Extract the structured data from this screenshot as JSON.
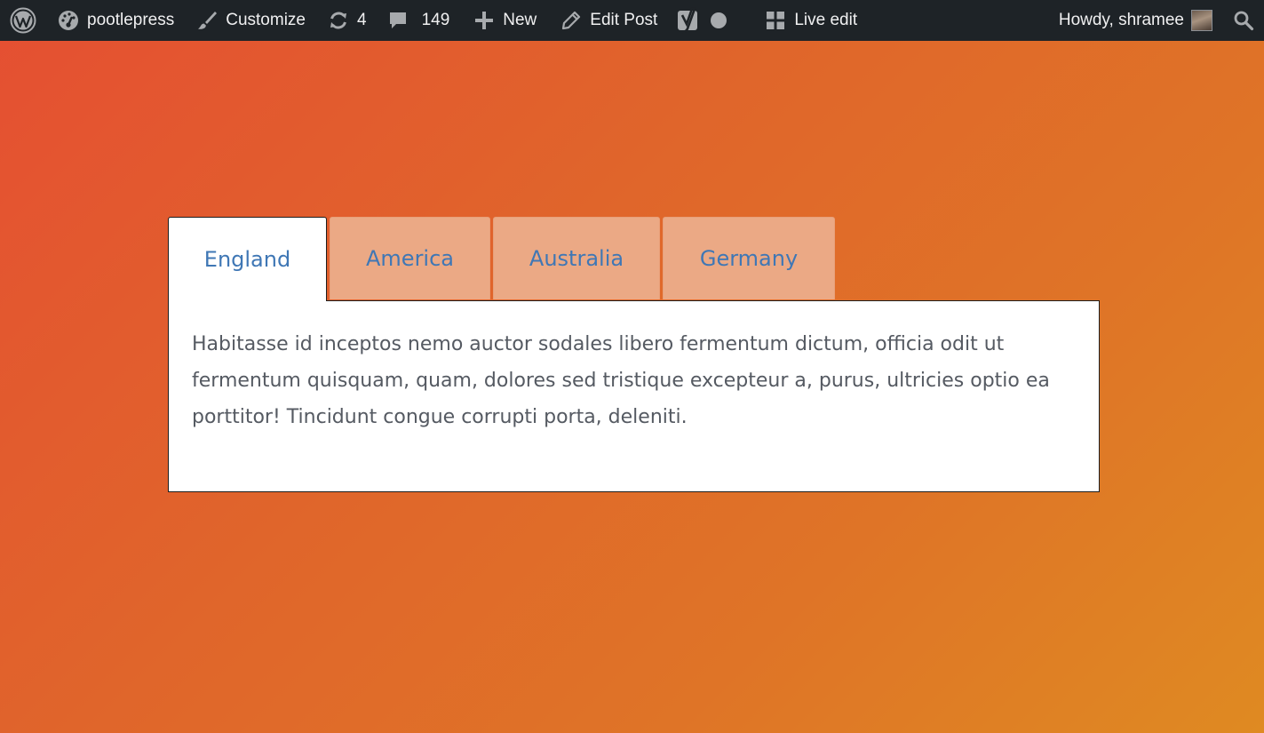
{
  "admin_bar": {
    "site_name": "pootlepress",
    "customize": "Customize",
    "updates_count": "4",
    "comments_count": "149",
    "new_label": "New",
    "edit_post": "Edit Post",
    "live_edit": "Live edit",
    "howdy": "Howdy, shramee",
    "icons": {
      "wordpress": "wordpress-logo-icon",
      "dashboard": "dashboard-gauge-icon",
      "customize": "paintbrush-icon",
      "updates": "refresh-icon",
      "comments": "speech-bubble-icon",
      "new": "plus-icon",
      "edit": "pencil-icon",
      "yoast": "yoast-seo-icon",
      "seo_status": "status-dot-icon",
      "live_edit": "grid-icon",
      "search": "search-icon"
    }
  },
  "tabs": {
    "items": [
      {
        "label": "England",
        "active": true
      },
      {
        "label": "America",
        "active": false
      },
      {
        "label": "Australia",
        "active": false
      },
      {
        "label": "Germany",
        "active": false
      }
    ],
    "content": "Habitasse id inceptos nemo auctor sodales libero fermentum dictum, officia odit ut fermentum quisquam, quam, dolores sed tristique excepteur a, purus, ultricies optio ea porttitor! Tincidunt congue corrupti porta, deleniti."
  },
  "colors": {
    "admin_bar_bg": "#1e2327",
    "tab_text": "#3f77b5",
    "inactive_tab_bg": "#eba985",
    "body_text": "#555a62",
    "gradient_start": "#e54f32",
    "gradient_end": "#df8a22"
  }
}
